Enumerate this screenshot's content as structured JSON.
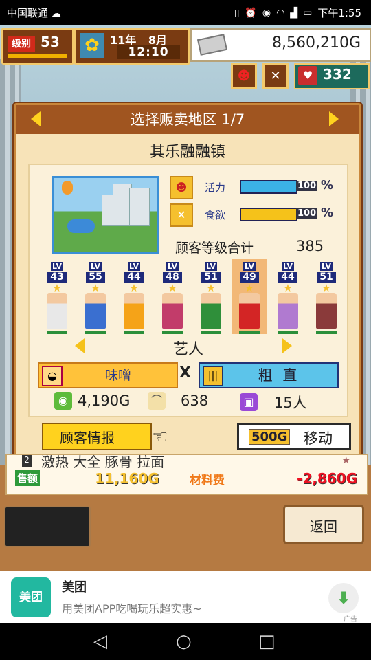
{
  "status_bar": {
    "carrier": "中国联通",
    "time": "下午1:55",
    "battery": "battery-icon"
  },
  "hud": {
    "level_label": "级别",
    "level": "53",
    "year": "11年",
    "month": "8月",
    "clock": "12:10",
    "money": "8,560,210G",
    "fans": "332"
  },
  "dialog": {
    "title": "选择贩卖地区 1/7",
    "district": "其乐融融镇",
    "stats": [
      {
        "label": "活力",
        "value": "100",
        "percent": 100,
        "color": "#3bb2e6"
      },
      {
        "label": "食欲",
        "value": "100",
        "percent": 100,
        "color": "#f5c21a"
      }
    ],
    "total_label": "顾客等级合计",
    "total_value": "385",
    "customers": [
      {
        "lv": "43",
        "color": "#e8e8e8"
      },
      {
        "lv": "55",
        "color": "#3a6fd0"
      },
      {
        "lv": "44",
        "color": "#f5a318"
      },
      {
        "lv": "48",
        "color": "#c23c6a"
      },
      {
        "lv": "51",
        "color": "#2f8f3a"
      },
      {
        "lv": "49",
        "color": "#d32525"
      },
      {
        "lv": "44",
        "color": "#b07ad0"
      },
      {
        "lv": "51",
        "color": "#8a3a3a"
      }
    ],
    "lv_tag": "LV",
    "customer_type": "艺人",
    "pref_left": "味噌",
    "pref_right": "粗 直",
    "pref_x": "X",
    "bottom_stats": {
      "money": "4,190G",
      "spoon": "638",
      "people": "15人"
    },
    "info_button": "顾客情报",
    "move_cost": "500G",
    "move_label": "移动"
  },
  "menu_row": {
    "num": "2",
    "name": "激热 大全 豚骨 拉面",
    "sales_label": "售额",
    "sales_value": "11,160G",
    "cost_label": "材料费",
    "cost_value": "-2,860G"
  },
  "back_label": "返回",
  "ad": {
    "logo": "美团",
    "title": "美团",
    "desc": "用美团APP吃喝玩乐超实惠~",
    "tag": "广告"
  }
}
